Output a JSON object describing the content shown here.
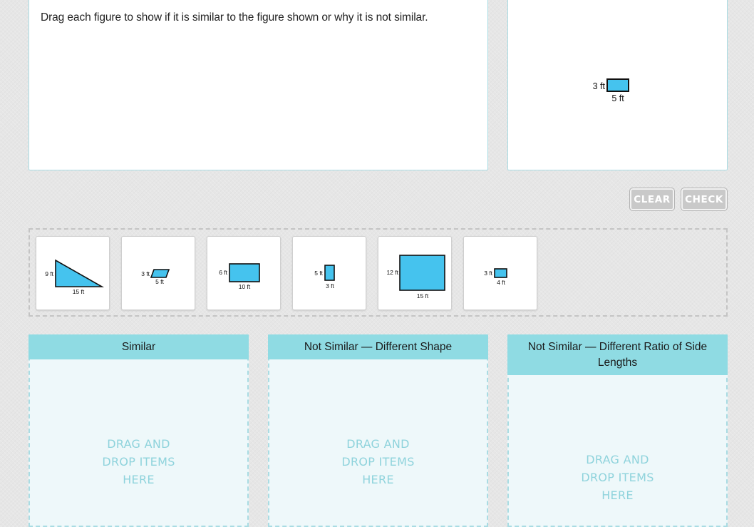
{
  "question": {
    "text": "Drag each figure to show if it is similar to the figure shown or why it is not similar."
  },
  "reference_figure": {
    "shape": "rectangle",
    "height_label": "3 ft",
    "width_label": "5 ft"
  },
  "buttons": {
    "clear": "CLEAR",
    "check": "CHECK"
  },
  "colors": {
    "shape_fill": "#45c3ee",
    "bin_header": "#8fdbe3",
    "bin_border": "#a9dce3",
    "drop_hint": "#8fd3dc",
    "button_disabled": "#c9c9c9"
  },
  "items": [
    {
      "shape": "right-triangle",
      "side_label": "9 ft",
      "base_label": "15 ft"
    },
    {
      "shape": "parallelogram",
      "side_label": "3 ft",
      "base_label": "5 ft"
    },
    {
      "shape": "rectangle",
      "side_label": "6 ft",
      "base_label": "10 ft"
    },
    {
      "shape": "rectangle",
      "side_label": "5 ft",
      "base_label": "3 ft"
    },
    {
      "shape": "rectangle",
      "side_label": "12 ft",
      "base_label": "15 ft"
    },
    {
      "shape": "rectangle",
      "side_label": "3 ft",
      "base_label": "4 ft"
    }
  ],
  "bins": [
    {
      "title": "Similar",
      "hint": [
        "DRAG AND",
        "DROP ITEMS",
        "HERE"
      ]
    },
    {
      "title": "Not Similar — Different Shape",
      "hint": [
        "DRAG AND",
        "DROP ITEMS",
        "HERE"
      ]
    },
    {
      "title": "Not Similar — Different Ratio of Side Lengths",
      "hint": [
        "DRAG AND",
        "DROP ITEMS",
        "HERE"
      ]
    }
  ]
}
